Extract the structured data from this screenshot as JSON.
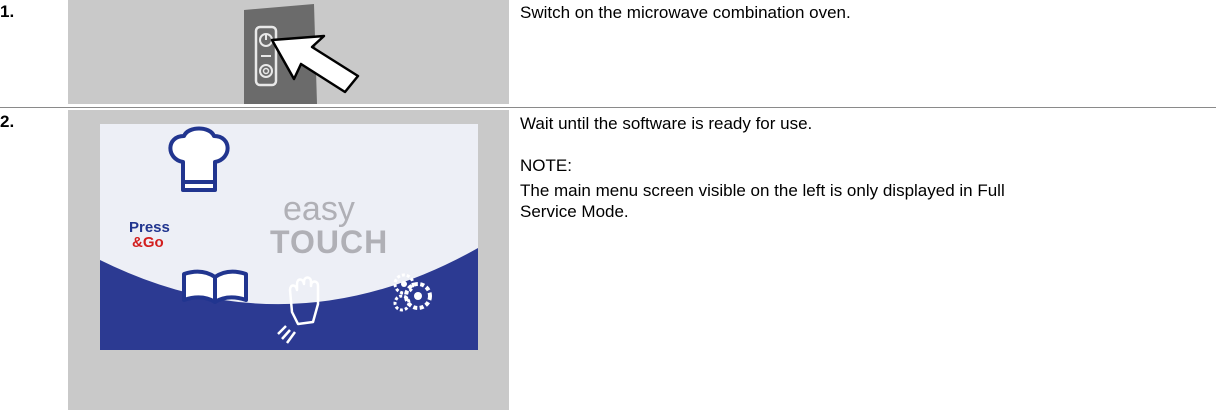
{
  "steps": [
    {
      "number": "1.",
      "lines": [
        "Switch on the microwave combination oven."
      ]
    },
    {
      "number": "2.",
      "lines": [
        "Wait until the software is ready for use."
      ],
      "note_label": "NOTE:",
      "note_lines": [
        "The main menu screen visible on the left is only displayed in Full",
        "Service Mode."
      ]
    }
  ],
  "screen": {
    "press": "Press",
    "go": "&Go",
    "easy": "easy",
    "touch": "TOUCH"
  },
  "colors": {
    "panel_gray": "#c9c9c9",
    "screen_bg": "#edeff6",
    "screen_blue": "#2c3a92",
    "press_red": "#d21e1e"
  }
}
